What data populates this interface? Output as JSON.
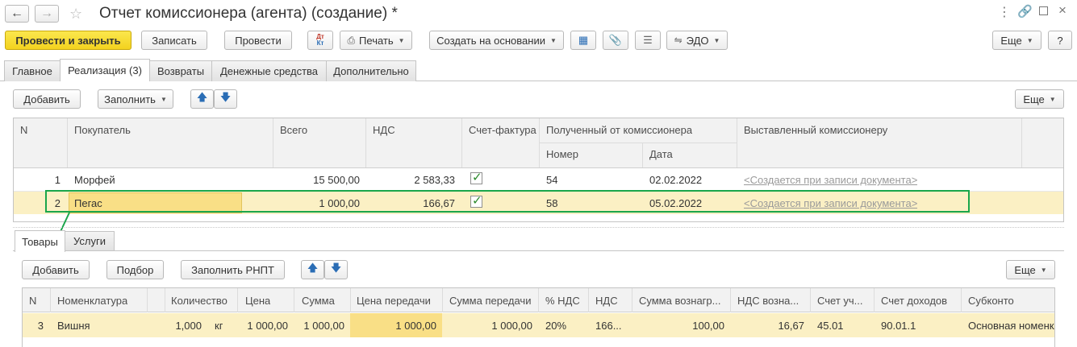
{
  "window": {
    "title": "Отчет комиссионера (агента) (создание) *"
  },
  "toolbar": {
    "post_close": "Провести и закрыть",
    "save": "Записать",
    "post": "Провести",
    "print": "Печать",
    "create_based": "Создать на основании",
    "edo": "ЭДО",
    "more": "Еще",
    "help": "?"
  },
  "tabs": [
    {
      "label": "Главное"
    },
    {
      "label": "Реализация (3)"
    },
    {
      "label": "Возвраты"
    },
    {
      "label": "Денежные средства"
    },
    {
      "label": "Дополнительно"
    }
  ],
  "sales": {
    "add": "Добавить",
    "fill": "Заполнить",
    "more": "Еще",
    "headers": {
      "n": "N",
      "buyer": "Покупатель",
      "total": "Всего",
      "vat": "НДС",
      "invoice": "Счет-фактура",
      "received": "Полученный от комиссионера",
      "number": "Номер",
      "date": "Дата",
      "issued": "Выставленный комиссионеру"
    },
    "rows": [
      {
        "n": "1",
        "buyer": "Морфей",
        "total": "15 500,00",
        "vat": "2 583,33",
        "number": "54",
        "date": "02.02.2022",
        "issued": "<Создается при записи документа>"
      },
      {
        "n": "2",
        "buyer": "Пегас",
        "total": "1 000,00",
        "vat": "166,67",
        "number": "58",
        "date": "05.02.2022",
        "issued": "<Создается при записи документа>"
      }
    ]
  },
  "subtabs": [
    {
      "label": "Товары"
    },
    {
      "label": "Услуги"
    }
  ],
  "goods": {
    "add": "Добавить",
    "select": "Подбор",
    "fill_rnpt": "Заполнить РНПТ",
    "more": "Еще",
    "headers": {
      "n": "N",
      "item": "Номенклатура",
      "qty": "Количество",
      "price": "Цена",
      "sum": "Сумма",
      "transfer_price": "Цена передачи",
      "transfer_sum": "Сумма передачи",
      "vat_rate": "% НДС",
      "vat": "НДС",
      "reward_sum": "Сумма вознагр...",
      "reward_vat": "НДС возна...",
      "account": "Счет уч...",
      "income_account": "Счет доходов",
      "subconto": "Субконто"
    },
    "rows": [
      {
        "n": "3",
        "item": "Вишня",
        "qty": "1,000",
        "unit": "кг",
        "price": "1 000,00",
        "sum": "1 000,00",
        "transfer_price": "1 000,00",
        "transfer_sum": "1 000,00",
        "vat_rate": "20%",
        "vat": "166...",
        "reward_sum": "100,00",
        "reward_vat": "16,67",
        "account": "45.01",
        "income_account": "90.01.1",
        "subconto": "Основная номенкл"
      }
    ]
  },
  "colors": {
    "accent_yellow": "#f3d21f",
    "selected_row": "#fbf0c4",
    "highlight_green": "#1aa64b",
    "check_green": "#2b8a2b"
  }
}
